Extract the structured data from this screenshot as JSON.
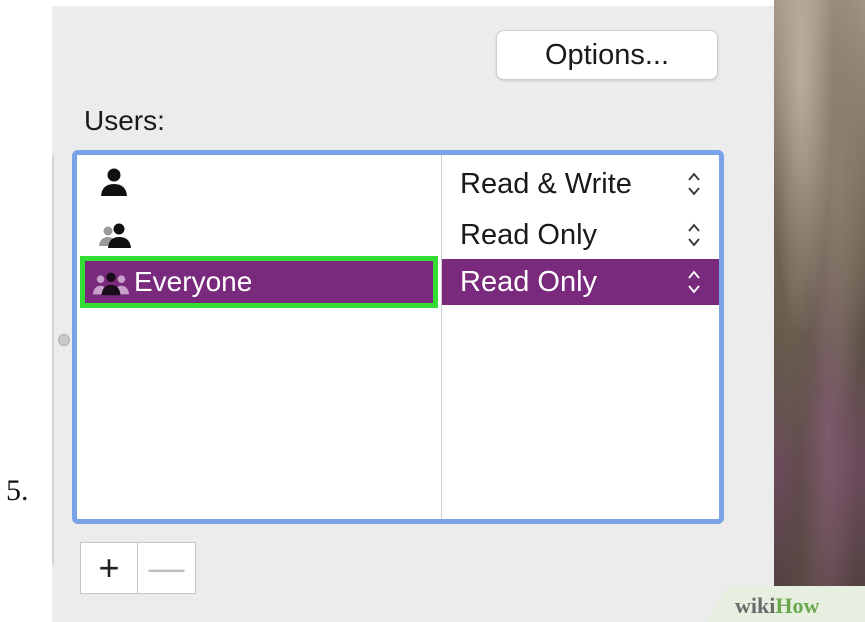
{
  "step": {
    "number": "5."
  },
  "options_button": {
    "label": "Options..."
  },
  "users_label": "Users:",
  "rows": [
    {
      "user_icon": "single-user-icon",
      "user_name": "",
      "permission": "Read & Write",
      "selected": false
    },
    {
      "user_icon": "group-icon",
      "user_name": "",
      "permission": "Read Only",
      "selected": false
    },
    {
      "user_icon": "everyone-icon",
      "user_name": "Everyone",
      "permission": "Read Only",
      "selected": true
    }
  ],
  "buttons": {
    "add": "+",
    "remove": "—"
  },
  "watermark": {
    "part1": "wiki",
    "part2": "How"
  },
  "colors": {
    "selection": "#7a2a7d",
    "focus_ring": "#7aa3e8",
    "highlight": "#33dd33"
  }
}
